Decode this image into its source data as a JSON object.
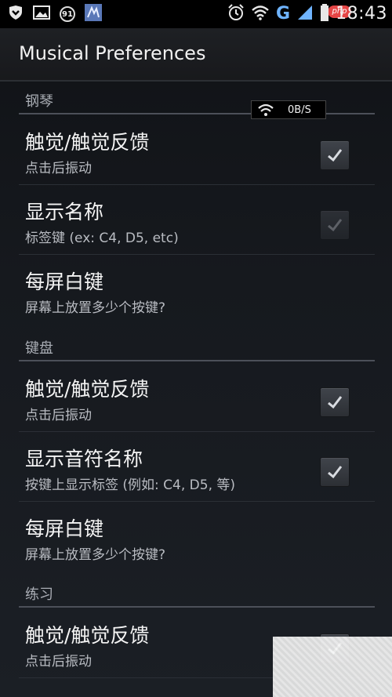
{
  "status_bar": {
    "notification_badge": "91",
    "network_type": "G",
    "time": "18:43",
    "watermark_logo": "php",
    "icons": [
      "shield-icon",
      "image-icon",
      "badge-91-icon",
      "app-icon",
      "alarm-clock-icon",
      "wifi-icon",
      "signal-icon",
      "battery-icon"
    ]
  },
  "action_bar": {
    "title": "Musical Preferences"
  },
  "speed_overlay": {
    "text": "0B/S"
  },
  "sections": [
    {
      "header": "钢琴",
      "items": [
        {
          "title": "触觉/触觉反馈",
          "summary": "点击后振动",
          "checkbox": "checked"
        },
        {
          "title": "显示名称",
          "summary": "标签键 (ex: C4, D5, etc)",
          "checkbox": "checked-disabled"
        },
        {
          "title": "每屏白键",
          "summary": "屏幕上放置多少个按键?",
          "checkbox": "none"
        }
      ]
    },
    {
      "header": "键盘",
      "items": [
        {
          "title": "触觉/触觉反馈",
          "summary": "点击后振动",
          "checkbox": "checked"
        },
        {
          "title": "显示音符名称",
          "summary": "按键上显示标签 (例如: C4, D5, 等)",
          "checkbox": "checked"
        },
        {
          "title": "每屏白键",
          "summary": "屏幕上放置多少个按键?",
          "checkbox": "none"
        }
      ]
    },
    {
      "header": "练习",
      "items": [
        {
          "title": "触觉/触觉反馈",
          "summary": "点击后振动",
          "checkbox": "checked"
        }
      ]
    }
  ],
  "colors": {
    "status_bar_bg": "#000000",
    "accent_blue": "#6fb4ff",
    "logo_red": "#e64545",
    "divider": "#4c5059"
  }
}
